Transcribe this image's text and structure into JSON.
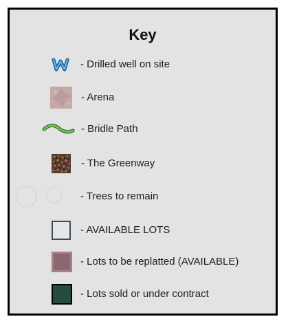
{
  "key": {
    "title": "Key",
    "items": [
      {
        "label": "- Drilled well on site",
        "icon": "well-icon",
        "color": "#2a8fd0"
      },
      {
        "label": "- Arena",
        "icon": "arena-swatch",
        "color": "#bfa6a6"
      },
      {
        "label": "- Bridle Path",
        "icon": "bridle-path-icon",
        "color": "#5fb34a"
      },
      {
        "label": "- The Greenway",
        "icon": "greenway-swatch",
        "color": "#6b4a3a"
      },
      {
        "label": "- Trees to remain",
        "icon": "tree-circles-icon",
        "color": "#c8c8c8"
      },
      {
        "label": "- AVAILABLE LOTS",
        "icon": "available-lot-swatch",
        "color": "#3a4e5a"
      },
      {
        "label": "- Lots to be replatted (AVAILABLE)",
        "icon": "replat-lot-swatch",
        "color": "#8c6770"
      },
      {
        "label": "- Lots sold or under contract",
        "icon": "sold-lot-swatch",
        "color": "#254c41"
      }
    ]
  }
}
